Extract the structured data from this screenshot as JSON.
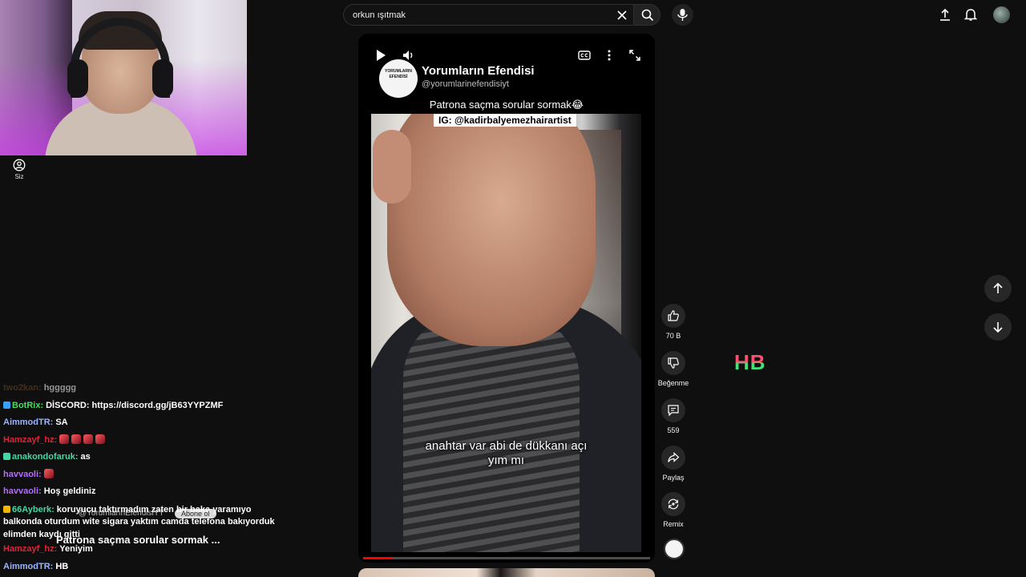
{
  "sidebar": {
    "you_label": "Siz"
  },
  "search": {
    "query": "orkun ışıtmak"
  },
  "header": {
    "icons": [
      "upload-icon",
      "bell-icon",
      "account-avatar"
    ]
  },
  "player": {
    "channel_name": "Yorumların Efendisi",
    "channel_handle": "@yorumlarinefendisiyt",
    "logo_text": "YORUMLARIN EFENDİSİ",
    "title": "Patrona saçma sorular sormak😂",
    "ig_tag": "IG: @kadirbalyemezhairartist",
    "caption_line1": "anahtar var abi de dükkanı açı",
    "caption_line2": "yım mı",
    "progress": 0.1,
    "controls": [
      "play-icon",
      "volume-icon",
      "captions-icon",
      "more-icon",
      "fullscreen-icon"
    ]
  },
  "actions": {
    "like_count": "70 B",
    "dislike_label": "Beğenme",
    "comment_count": "559",
    "share_label": "Paylaş",
    "remix_label": "Remix"
  },
  "overlay": {
    "hb_text": "HB",
    "short_handle": "@YorumlarınEfendisiYT",
    "subscribe_label": "Abone ol",
    "short_title": "Patrona saçma sorular sormak ..."
  },
  "chat": {
    "messages": [
      {
        "user": "two2kan:",
        "text": "hggggg",
        "color": "#6b4a2a"
      },
      {
        "user": "BotRix:",
        "text": "DİSCORD: https://discord.gg/jB63YYPZMF",
        "color": "#4cd964"
      },
      {
        "user": "AimmodTR:",
        "text": "SA",
        "color": "#9cb3ff"
      },
      {
        "user": "Hamzayf_hz:",
        "text": "",
        "color": "#e0243a"
      },
      {
        "user": "anakondofaruk:",
        "text": "as",
        "color": "#45d6a8"
      },
      {
        "user": "havvaoli:",
        "text": "",
        "color": "#b46bff"
      },
      {
        "user": "havvaoli:",
        "text": "Hoş geldiniz",
        "color": "#b46bff"
      },
      {
        "user": "66Ayberk:",
        "text": "koruyucu taktırmadım zaten bir baka yaramıyo balkonda oturdum wite sigara yaktım camda telefona bakıyorduk elimden kaydı gitti",
        "color": "#45d6a8"
      },
      {
        "user": "Hamzayf_hz:",
        "text": "Yeniyim",
        "color": "#e0243a"
      },
      {
        "user": "AimmodTR:",
        "text": "HB",
        "color": "#9cb3ff"
      }
    ]
  }
}
